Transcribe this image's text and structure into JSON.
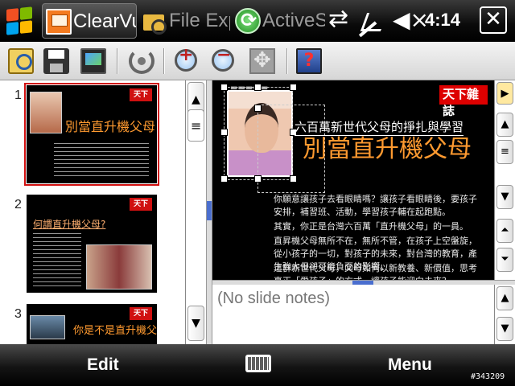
{
  "taskbar": {
    "tabs": [
      {
        "label": "ClearVue PPT",
        "icon": "presentation-icon"
      },
      {
        "label": "File Explorer",
        "icon": "folder-search-icon"
      },
      {
        "label": "ActiveSync",
        "icon": "sync-icon"
      }
    ],
    "tray": {
      "data_icon": "⇄",
      "volume_icon": "◀×",
      "time": "4:14",
      "close_label": "✕"
    }
  },
  "toolbar": {
    "buttons": [
      "open-icon",
      "save-icon",
      "slideshow-icon",
      "rotate-icon",
      "zoom-in-icon",
      "zoom-out-icon",
      "pan-icon",
      "help-icon"
    ]
  },
  "thumbnails": [
    {
      "number": "1",
      "badge": "天下",
      "title": "別當直升機父母",
      "selected": true
    },
    {
      "number": "2",
      "badge": "天下",
      "title": "何謂直升機父母?",
      "selected": false
    },
    {
      "number": "3",
      "badge": "天下",
      "title": "你是不是直升機父",
      "selected": false
    }
  ],
  "slide": {
    "badge": "天下雜誌",
    "subtitle": "六百萬新世代父母的掙扎與學習",
    "title": "別當直升機父母",
    "paragraphs": [
      "你願意讓孩子去看眼睛嗎？讓孩子看眼睛後，要孩子安排，補習班、活動，學習孩子輔在起跑點。",
      "其實，你正是台灣六百萬「直升機父母」的一員。",
      "直昇機父母無所不在，無所不管，在孩子上空盤旋，從小孩子的一切，對孩子的未來，對台灣的教育，產生強大但卻可能負面的影響。",
      "這群新世代父母，父母如何以新教養、新價值，思考真正「愛孩子」的方式，讓孩子能迎向未來？"
    ]
  },
  "notes": {
    "text": "(No slide notes)"
  },
  "softkeys": {
    "left": "Edit",
    "right": "Menu"
  },
  "build_id": "#343209"
}
